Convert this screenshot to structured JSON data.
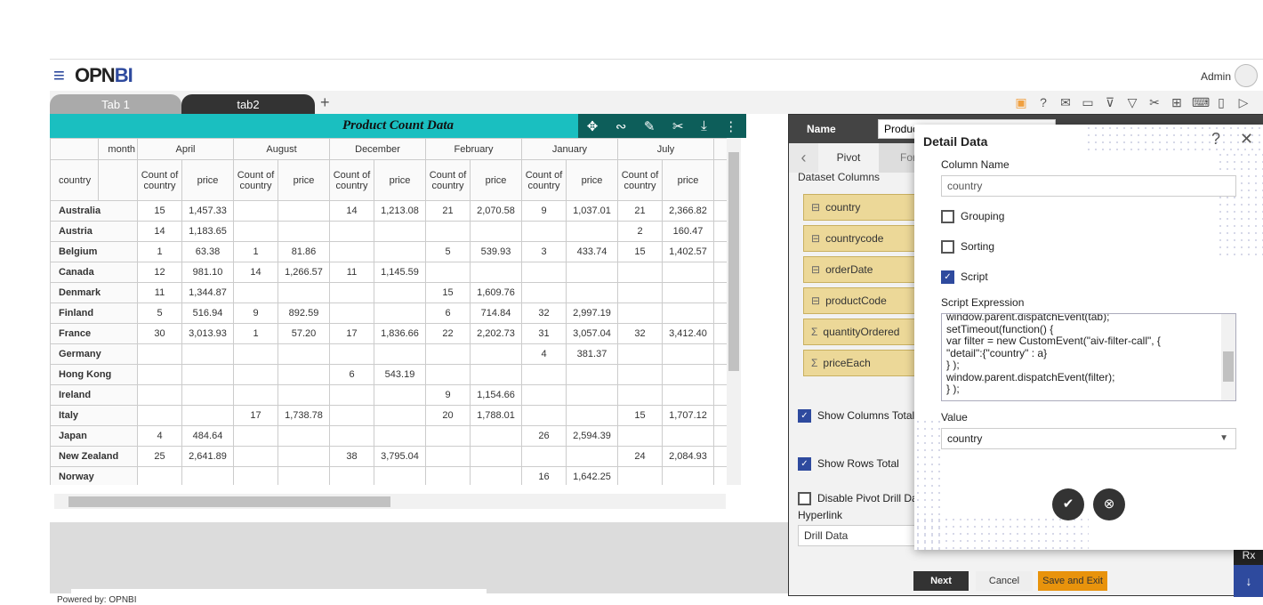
{
  "header": {
    "logo_prefix": "OPN",
    "logo_suffix": "BI",
    "user": "Admin"
  },
  "tabs": [
    {
      "label": "Tab 1"
    },
    {
      "label": "tab2"
    }
  ],
  "add_tab": "+",
  "toolbar_icons": [
    "save-icon",
    "help-icon",
    "mail-icon",
    "comment-icon",
    "clear-filter-icon",
    "filter-icon",
    "tools-icon",
    "table-icon",
    "embed-icon",
    "devices-icon",
    "play-icon"
  ],
  "widget": {
    "title": "Product Count Data",
    "icons": [
      "move-icon",
      "link-icon",
      "edit-icon",
      "tools-icon",
      "download-icon",
      "more-icon"
    ],
    "table": {
      "row_field": "country",
      "col_field": "month",
      "months": [
        "April",
        "August",
        "December",
        "February",
        "January",
        "July"
      ],
      "measures": [
        "Count of country",
        "price"
      ],
      "rows": [
        {
          "country": "Australia",
          "values": [
            "15",
            "1,457.33",
            "",
            "",
            "14",
            "1,213.08",
            "21",
            "2,070.58",
            "9",
            "1,037.01",
            "21",
            "2,366.82"
          ]
        },
        {
          "country": "Austria",
          "values": [
            "14",
            "1,183.65",
            "",
            "",
            "",
            "",
            "",
            "",
            "",
            "",
            "2",
            "160.47"
          ]
        },
        {
          "country": "Belgium",
          "values": [
            "1",
            "63.38",
            "1",
            "81.86",
            "",
            "",
            "5",
            "539.93",
            "3",
            "433.74",
            "15",
            "1,402.57"
          ]
        },
        {
          "country": "Canada",
          "values": [
            "12",
            "981.10",
            "14",
            "1,266.57",
            "11",
            "1,145.59",
            "",
            "",
            "",
            "",
            "",
            ""
          ]
        },
        {
          "country": "Denmark",
          "values": [
            "11",
            "1,344.87",
            "",
            "",
            "",
            "",
            "15",
            "1,609.76",
            "",
            "",
            "",
            ""
          ]
        },
        {
          "country": "Finland",
          "values": [
            "5",
            "516.94",
            "9",
            "892.59",
            "",
            "",
            "6",
            "714.84",
            "32",
            "2,997.19",
            "",
            ""
          ]
        },
        {
          "country": "France",
          "values": [
            "30",
            "3,013.93",
            "1",
            "57.20",
            "17",
            "1,836.66",
            "22",
            "2,202.73",
            "31",
            "3,057.04",
            "32",
            "3,412.40"
          ]
        },
        {
          "country": "Germany",
          "values": [
            "",
            "",
            "",
            "",
            "",
            "",
            "",
            "",
            "4",
            "381.37",
            "",
            ""
          ]
        },
        {
          "country": "Hong Kong",
          "values": [
            "",
            "",
            "",
            "",
            "6",
            "543.19",
            "",
            "",
            "",
            "",
            "",
            ""
          ]
        },
        {
          "country": "Ireland",
          "values": [
            "",
            "",
            "",
            "",
            "",
            "",
            "9",
            "1,154.66",
            "",
            "",
            "",
            ""
          ]
        },
        {
          "country": "Italy",
          "values": [
            "",
            "",
            "17",
            "1,738.78",
            "",
            "",
            "20",
            "1,788.01",
            "",
            "",
            "15",
            "1,707.12"
          ]
        },
        {
          "country": "Japan",
          "values": [
            "4",
            "484.64",
            "",
            "",
            "",
            "",
            "",
            "",
            "26",
            "2,594.39",
            "",
            ""
          ]
        },
        {
          "country": "New Zealand",
          "values": [
            "25",
            "2,641.89",
            "",
            "",
            "38",
            "3,795.04",
            "",
            "",
            "",
            "",
            "24",
            "2,084.93"
          ]
        },
        {
          "country": "Norway",
          "values": [
            "",
            "",
            "",
            "",
            "",
            "",
            "",
            "",
            "16",
            "1,642.25",
            "",
            ""
          ]
        }
      ]
    }
  },
  "footer": "Powered by: OPNBI",
  "panel": {
    "name_label": "Name",
    "name_value": "Product Count Data",
    "tabs": [
      "Pivot",
      "Format"
    ],
    "dataset_label": "Dataset Columns",
    "columns": [
      {
        "name": "country",
        "icon": "table-icon"
      },
      {
        "name": "countrycode",
        "icon": "table-icon"
      },
      {
        "name": "orderDate",
        "icon": "table-icon"
      },
      {
        "name": "productCode",
        "icon": "table-icon"
      },
      {
        "name": "quantityOrdered",
        "icon": "sigma-icon"
      },
      {
        "name": "priceEach",
        "icon": "sigma-icon"
      }
    ],
    "show_columns_total": {
      "label": "Show Columns Total",
      "checked": true
    },
    "show_rows_total": {
      "label": "Show Rows Total",
      "checked": true
    },
    "disable_drill": {
      "label": "Disable Pivot Drill Data",
      "checked": false
    },
    "hyperlink_label": "Hyperlink",
    "hyperlink_value": "Drill Data",
    "next": "Next",
    "cancel": "Cancel",
    "save_exit": "Save and Exit",
    "rx": "Rx",
    "download": "↓"
  },
  "modal": {
    "title": "Detail Data",
    "help": "?",
    "close": "✕",
    "column_name_label": "Column Name",
    "column_name_value": "country",
    "grouping": {
      "label": "Grouping",
      "checked": false
    },
    "sorting": {
      "label": "Sorting",
      "checked": false
    },
    "script": {
      "label": "Script",
      "checked": true
    },
    "script_expression_label": "Script Expression",
    "script_expression": "window.parent.dispatchEvent(tab);\nsetTimeout(function() {\nvar filter = new CustomEvent(\"aiv-filter-call\", {\n\"detail\":{\"country\" : a}\n} );\nwindow.parent.dispatchEvent(filter);\n} );",
    "value_label": "Value",
    "value": "country"
  },
  "colors": {
    "accent": "#2e4a9e",
    "title_bar": "#1abfc0",
    "title_icons": "#0d5e5a",
    "save_exit": "#e8930c",
    "column_chip": "#ecd898"
  }
}
